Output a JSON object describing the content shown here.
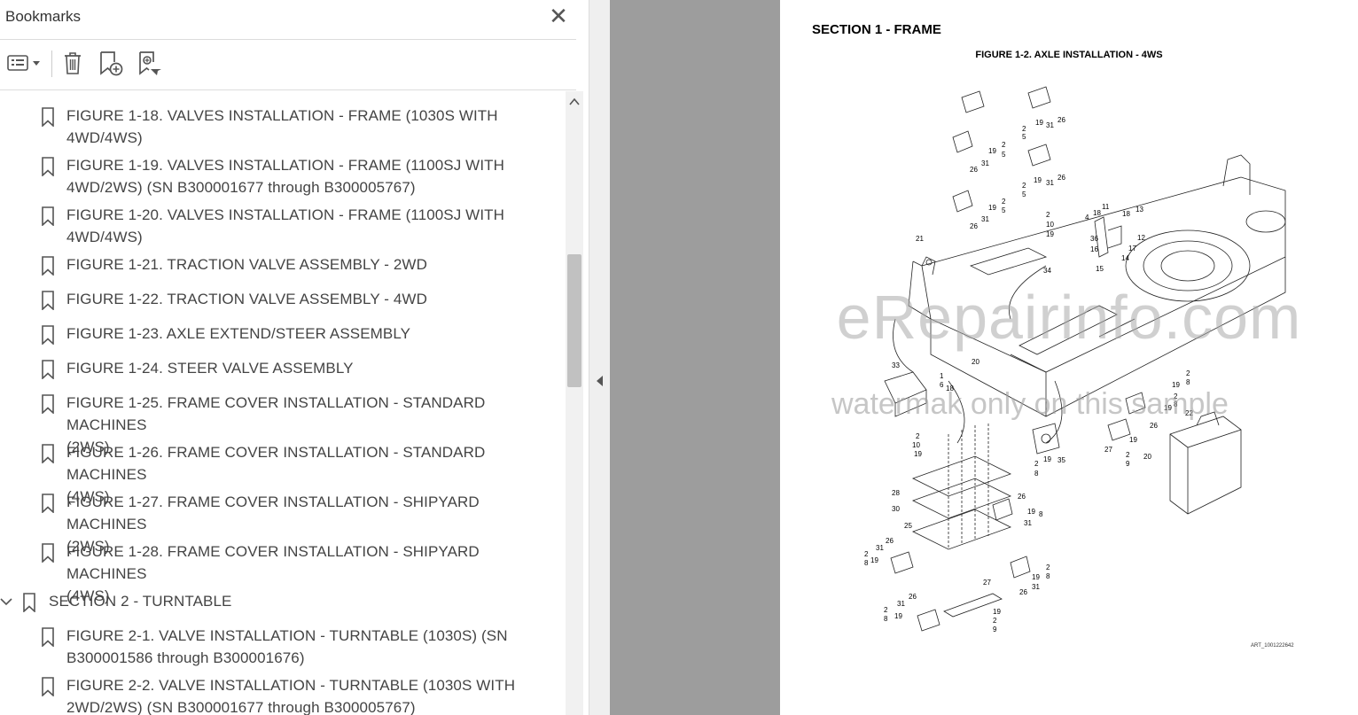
{
  "bookmarks_panel": {
    "title": "Bookmarks",
    "close_glyph": "✕",
    "items": [
      {
        "text": "FIGURE 1-18. VALVES INSTALLATION - FRAME (1030S WITH\n4WD/4WS)"
      },
      {
        "text": "FIGURE 1-19. VALVES INSTALLATION - FRAME (1100SJ WITH\n4WD/2WS) (SN B300001677 through B300005767)"
      },
      {
        "text": "FIGURE 1-20. VALVES INSTALLATION - FRAME (1100SJ WITH\n4WD/4WS)"
      },
      {
        "text": "FIGURE 1-21. TRACTION VALVE ASSEMBLY - 2WD"
      },
      {
        "text": "FIGURE 1-22. TRACTION VALVE ASSEMBLY - 4WD"
      },
      {
        "text": "FIGURE 1-23. AXLE EXTEND/STEER ASSEMBLY"
      },
      {
        "text": "FIGURE 1-24. STEER VALVE ASSEMBLY"
      },
      {
        "text": "FIGURE 1-25. FRAME COVER INSTALLATION - STANDARD MACHINES\n(2WS)"
      },
      {
        "text": "FIGURE 1-26. FRAME COVER INSTALLATION - STANDARD MACHINES\n(4WS)"
      },
      {
        "text": "FIGURE 1-27. FRAME COVER INSTALLATION - SHIPYARD MACHINES\n(2WS)"
      },
      {
        "text": "FIGURE 1-28. FRAME COVER INSTALLATION - SHIPYARD MACHINES\n(4WS)"
      },
      {
        "text": "SECTION 2 - TURNTABLE"
      },
      {
        "text": "FIGURE 2-1. VALVE INSTALLATION - TURNTABLE (1030S) (SN\nB300001586 through B300001676)"
      },
      {
        "text": "FIGURE 2-2. VALVE INSTALLATION - TURNTABLE (1030S WITH\n2WD/2WS) (SN B300001677 through B300005767)"
      }
    ]
  },
  "toolbar_icons": [
    "options-menu-icon",
    "delete-bookmark-icon",
    "new-bookmark-icon",
    "find-current-bookmark-icon"
  ],
  "page": {
    "section_title": "SECTION 1 - FRAME",
    "figure_title": "FIGURE 1-2. AXLE INSTALLATION - 4WS",
    "art_id": "ART_1001222642",
    "watermark_main": "eRepairinfo.com",
    "watermark_sub": "watermak only on this sample",
    "callouts": [
      "26",
      "19",
      "31",
      "2",
      "5",
      "19",
      "31",
      "26",
      "2",
      "5",
      "19",
      "31",
      "26",
      "2",
      "5",
      "19",
      "31",
      "26",
      "2",
      "5",
      "2",
      "10",
      "19",
      "34",
      "11",
      "4",
      "18",
      "18",
      "13",
      "36",
      "12",
      "16",
      "17",
      "15",
      "14",
      "21",
      "33",
      "1",
      "6",
      "18",
      "20",
      "2",
      "19",
      "8",
      "2",
      "19",
      "8",
      "19",
      "22",
      "2",
      "10",
      "19",
      "35",
      "2",
      "8",
      "19",
      "27",
      "2",
      "9",
      "20",
      "26",
      "28",
      "30",
      "25",
      "26",
      "19",
      "8",
      "31",
      "31",
      "26",
      "8",
      "19",
      "2",
      "2",
      "8",
      "19",
      "31",
      "26",
      "27",
      "31",
      "26",
      "2",
      "8",
      "19",
      "19",
      "2",
      "9"
    ]
  },
  "colors": {
    "panel_bg": "#ffffff",
    "viewer_bg": "#9d9d9d",
    "text": "#444444",
    "scroll_thumb": "#c1c1c1"
  }
}
